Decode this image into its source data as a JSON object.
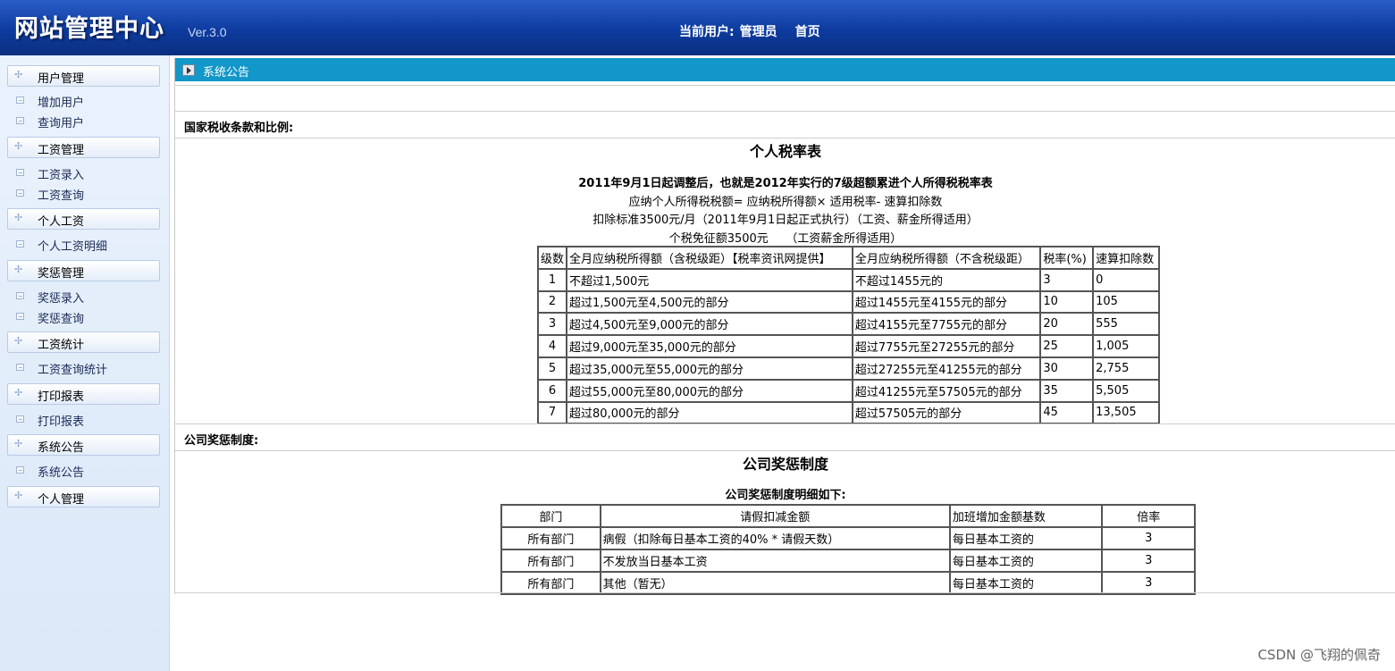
{
  "header": {
    "title": "网站管理中心",
    "version": "Ver.3.0",
    "current_user_label": "当前用户:",
    "user": "管理员",
    "home": "首页"
  },
  "sidebar": {
    "groups": [
      {
        "label": "用户管理",
        "items": [
          "增加用户",
          "查询用户"
        ]
      },
      {
        "label": "工资管理",
        "items": [
          "工资录入",
          "工资查询"
        ]
      },
      {
        "label": "个人工资",
        "items": [
          "个人工资明细"
        ]
      },
      {
        "label": "奖惩管理",
        "items": [
          "奖惩录入",
          "奖惩查询"
        ]
      },
      {
        "label": "工资统计",
        "items": [
          "工资查询统计"
        ]
      },
      {
        "label": "打印报表",
        "items": [
          "打印报表"
        ]
      },
      {
        "label": "系统公告",
        "items": [
          "系统公告"
        ]
      },
      {
        "label": "个人管理",
        "items": []
      }
    ]
  },
  "main": {
    "panel_title": "系统公告",
    "tax_section_label": "国家税收条款和比例:",
    "tax_title": "个人税率表",
    "tax_subtitle": "2011年9月1日起调整后，也就是2012年实行的7级超额累进个人所得税税率表",
    "tax_formula": "应纳个人所得税税额= 应纳税所得额× 适用税率- 速算扣除数",
    "tax_standard": "扣除标准3500元/月（2011年9月1日起正式执行）（工资、薪金所得适用）",
    "tax_threshold": "个税免征额3500元　　（工资薪金所得适用）",
    "tax_table": {
      "headers": [
        "级数",
        "全月应纳税所得额（含税级距）【税率资讯网提供】",
        "全月应纳税所得额（不含税级距）",
        "税率(%)",
        "速算扣除数"
      ],
      "rows": [
        [
          "1",
          "不超过1,500元",
          "不超过1455元的",
          "3",
          "0"
        ],
        [
          "2",
          "超过1,500元至4,500元的部分",
          "超过1455元至4155元的部分",
          "10",
          "105"
        ],
        [
          "3",
          "超过4,500元至9,000元的部分",
          "超过4155元至7755元的部分",
          "20",
          "555"
        ],
        [
          "4",
          "超过9,000元至35,000元的部分",
          "超过7755元至27255元的部分",
          "25",
          "1,005"
        ],
        [
          "5",
          "超过35,000元至55,000元的部分",
          "超过27255元至41255元的部分",
          "30",
          "2,755"
        ],
        [
          "6",
          "超过55,000元至80,000元的部分",
          "超过41255元至57505元的部分",
          "35",
          "5,505"
        ],
        [
          "7",
          "超过80,000元的部分",
          "超过57505元的部分",
          "45",
          "13,505"
        ]
      ]
    },
    "reward_section_label": "公司奖惩制度:",
    "reward_title": "公司奖惩制度",
    "reward_subtitle": "公司奖惩制度明细如下:",
    "reward_table": {
      "headers": [
        "部门",
        "请假扣减金额",
        "加班增加金额基数",
        "倍率"
      ],
      "rows": [
        [
          "所有部门",
          "病假（扣除每日基本工资的40% * 请假天数）",
          "每日基本工资的",
          "3"
        ],
        [
          "所有部门",
          "不发放当日基本工资",
          "每日基本工资的",
          "3"
        ],
        [
          "所有部门",
          "其他（暂无）",
          "每日基本工资的",
          "3"
        ]
      ]
    }
  },
  "watermark": "CSDN @飞翔的佩奇"
}
